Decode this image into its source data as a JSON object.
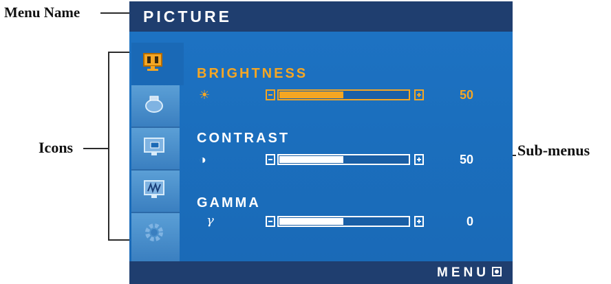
{
  "callouts": {
    "menu_name": "Menu Name",
    "icons": "Icons",
    "sub_menus": "Sub-menus"
  },
  "osd": {
    "title": "PICTURE",
    "bottom_label": "MENU",
    "bottom_icon": "menu-button-icon",
    "sidebar_icons": [
      {
        "name": "picture-monitor-icon",
        "active": true
      },
      {
        "name": "color-temperature-icon",
        "active": false
      },
      {
        "name": "display-position-icon",
        "active": false
      },
      {
        "name": "tracking-icon",
        "active": false
      },
      {
        "name": "setup-gear-icon",
        "active": false
      }
    ],
    "items": [
      {
        "label": "BRIGHTNESS",
        "symbol": "☀",
        "value": "50",
        "level": 0.5,
        "selected": true
      },
      {
        "label": "CONTRAST",
        "symbol": "◑",
        "value": "50",
        "level": 0.5,
        "selected": false
      },
      {
        "label": "GAMMA",
        "symbol": "γ",
        "value": "0",
        "level": 0.5,
        "selected": false
      }
    ]
  },
  "colors": {
    "osd_background": "#1b6fbe",
    "title_bar": "#1f3e6f",
    "highlight": "#f5a623",
    "text": "#ffffff"
  }
}
